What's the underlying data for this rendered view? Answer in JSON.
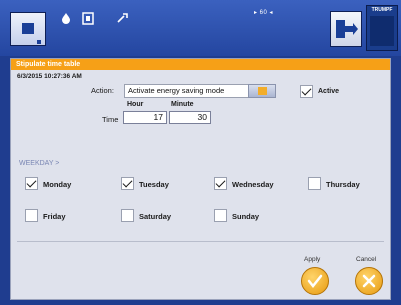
{
  "toolbar": {
    "status_text": "▸ 60 ◂",
    "logo_text": "TRUMPF"
  },
  "dialog": {
    "title": "Stipulate time table",
    "datetime": "6/3/2015 10:27:36 AM",
    "action_label": "Action:",
    "action_value": "Activate energy saving mode",
    "active_label": "Active",
    "active_checked": true,
    "time_label": "Time",
    "hour_label": "Hour",
    "minute_label": "Minute",
    "hour_value": "17",
    "minute_value": "30",
    "weekday_label": "WEEKDAY >",
    "days": [
      {
        "label": "Monday",
        "checked": true
      },
      {
        "label": "Tuesday",
        "checked": true
      },
      {
        "label": "Wednesday",
        "checked": true
      },
      {
        "label": "Thursday",
        "checked": false
      },
      {
        "label": "Friday",
        "checked": false
      },
      {
        "label": "Saturday",
        "checked": false
      },
      {
        "label": "Sunday",
        "checked": false
      }
    ],
    "apply_label": "Apply",
    "cancel_label": "Cancel"
  },
  "colors": {
    "accent": "#f6a017",
    "toolbar_bg": "#2446a0"
  }
}
